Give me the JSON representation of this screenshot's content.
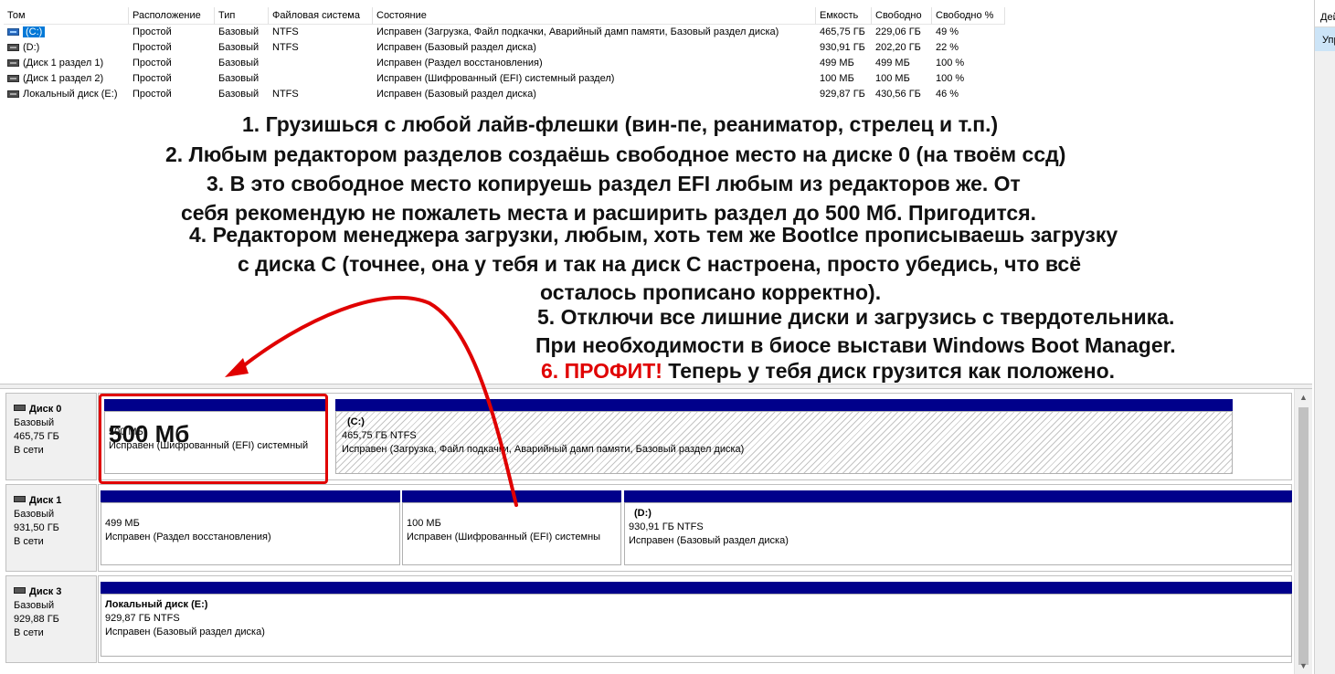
{
  "columns": [
    "Том",
    "Расположение",
    "Тип",
    "Файловая система",
    "Состояние",
    "Емкость",
    "Свободно",
    "Свободно %"
  ],
  "volumes": [
    {
      "name": "(C:)",
      "location": "Простой",
      "type": "Базовый",
      "fs": "NTFS",
      "status": "Исправен (Загрузка, Файл подкачки, Аварийный дамп памяти, Базовый раздел диска)",
      "capacity": "465,75 ГБ",
      "free": "229,06 ГБ",
      "free_pct": "49 %"
    },
    {
      "name": "(D:)",
      "location": "Простой",
      "type": "Базовый",
      "fs": "NTFS",
      "status": "Исправен (Базовый раздел диска)",
      "capacity": "930,91 ГБ",
      "free": "202,20 ГБ",
      "free_pct": "22 %"
    },
    {
      "name": "(Диск 1 раздел 1)",
      "location": "Простой",
      "type": "Базовый",
      "fs": "",
      "status": "Исправен (Раздел восстановления)",
      "capacity": "499 МБ",
      "free": "499 МБ",
      "free_pct": "100 %"
    },
    {
      "name": "(Диск 1 раздел 2)",
      "location": "Простой",
      "type": "Базовый",
      "fs": "",
      "status": "Исправен (Шифрованный (EFI) системный раздел)",
      "capacity": "100 МБ",
      "free": "100 МБ",
      "free_pct": "100 %"
    },
    {
      "name": "Локальный диск (E:)",
      "location": "Простой",
      "type": "Базовый",
      "fs": "NTFS",
      "status": "Исправен (Базовый раздел диска)",
      "capacity": "929,87 ГБ",
      "free": "430,56 ГБ",
      "free_pct": "46 %"
    }
  ],
  "instructions": {
    "line1": "1. Грузишься с любой лайв-флешки (вин-пе, реаниматор, стрелец и т.п.)",
    "line2": "2. Любым редактором разделов создаёшь свободное место на диске 0 (на твоём ссд)",
    "line3a": "3. В это свободное место копируешь раздел EFI любым из редакторов же. От",
    "line3b": "себя рекомендую не пожалеть места и расширить раздел до 500 Мб. Пригодится.",
    "line4a": "4. Редактором менеджера загрузки, любым, хоть тем же BootIce прописываешь загрузку",
    "line4b": "с диска С (точнее, она у тебя и так на диск С настроена, просто убедись, что всё",
    "line4c": "осталось прописано корректно).",
    "line5a": "5. Отключи все лишние диски и загрузись с твердотельника.",
    "line5b": "При необходимости в биосе выстави Windows Boot Manager.",
    "line6_red": "6. ПРОФИТ!",
    "line6_rest": " Теперь у тебя диск грузится как положено.",
    "overlay_size": "500 Мб"
  },
  "disks": [
    {
      "name": "Диск 0",
      "type": "Базовый",
      "size": "465,75 ГБ",
      "status": "В сети",
      "partitions": [
        {
          "title": "",
          "size": "500 МБ",
          "status": "Исправен (Шифрованный (EFI) системный"
        },
        {
          "title": "(C:)",
          "size": "465,75 ГБ NTFS",
          "status": "Исправен (Загрузка, Файл подкачки, Аварийный дамп памяти, Базовый раздел диска)"
        }
      ]
    },
    {
      "name": "Диск 1",
      "type": "Базовый",
      "size": "931,50 ГБ",
      "status": "В сети",
      "partitions": [
        {
          "title": "",
          "size": "499 МБ",
          "status": "Исправен (Раздел восстановления)"
        },
        {
          "title": "",
          "size": "100 МБ",
          "status": "Исправен (Шифрованный (EFI) системны"
        },
        {
          "title": "(D:)",
          "size": "930,91 ГБ NTFS",
          "status": "Исправен (Базовый раздел диска)"
        }
      ]
    },
    {
      "name": "Диск 3",
      "type": "Базовый",
      "size": "929,88 ГБ",
      "status": "В сети",
      "partitions": [
        {
          "title": "Локальный диск  (E:)",
          "size": "929,87 ГБ NTFS",
          "status": "Исправен (Базовый раздел диска)"
        }
      ]
    }
  ],
  "right_panel": {
    "header": "Действия",
    "item": "Управление дисками"
  },
  "colors": {
    "partition_bar": "#00008b",
    "selection": "#0078d7",
    "annotation_red": "#e00000"
  }
}
